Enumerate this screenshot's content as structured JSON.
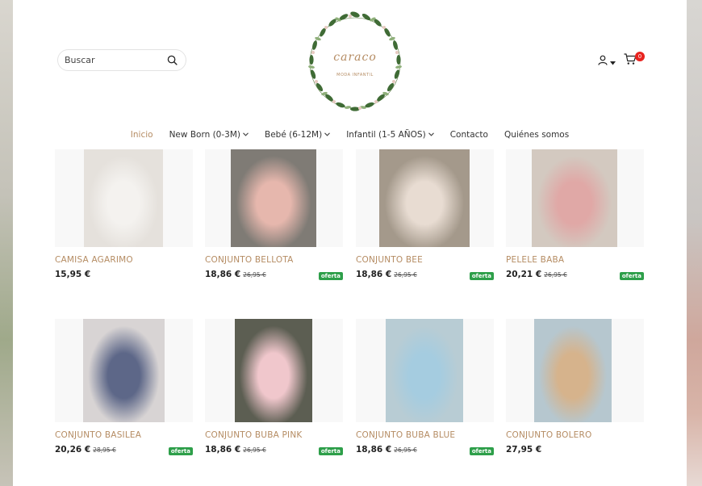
{
  "header": {
    "search": {
      "placeholder": "Buscar",
      "value": ""
    },
    "logo": {
      "brand": "caraco",
      "tagline": "MODA INFANTIL"
    },
    "cart": {
      "count": "0"
    }
  },
  "nav": {
    "items": [
      {
        "label": "Inicio",
        "active": true,
        "has_dropdown": false
      },
      {
        "label": "New Born (0-3M)",
        "active": false,
        "has_dropdown": true
      },
      {
        "label": "Bebé (6-12M)",
        "active": false,
        "has_dropdown": true
      },
      {
        "label": "Infantil (1-5 AÑOS)",
        "active": false,
        "has_dropdown": true
      },
      {
        "label": "Contacto",
        "active": false,
        "has_dropdown": false
      },
      {
        "label": "Quiénes somos",
        "active": false,
        "has_dropdown": false
      }
    ]
  },
  "products": [
    {
      "name": "CAMISA AGARIMO",
      "price": "15,95 €",
      "old_price": "",
      "badge": ""
    },
    {
      "name": "CONJUNTO BELLOTA",
      "price": "18,86 €",
      "old_price": "26,95 €",
      "badge": "oferta"
    },
    {
      "name": "CONJUNTO BEE",
      "price": "18,86 €",
      "old_price": "26,95 €",
      "badge": "oferta"
    },
    {
      "name": "PELELE BABA",
      "price": "20,21 €",
      "old_price": "26,95 €",
      "badge": "oferta"
    },
    {
      "name": "CONJUNTO BASILEA",
      "price": "20,26 €",
      "old_price": "28,95 €",
      "badge": "oferta"
    },
    {
      "name": "CONJUNTO BUBA PINK",
      "price": "18,86 €",
      "old_price": "26,95 €",
      "badge": "oferta"
    },
    {
      "name": "CONJUNTO BUBA BLUE",
      "price": "18,86 €",
      "old_price": "26,95 €",
      "badge": "oferta"
    },
    {
      "name": "CONJUNTO BOLERO",
      "price": "27,95 €",
      "old_price": "",
      "badge": ""
    }
  ],
  "colors": {
    "accent": "#b58c63",
    "badge": "#2e9f4a",
    "cart_badge": "#e8231f"
  },
  "icons": [
    "search-icon",
    "user-icon",
    "chevron-down-icon",
    "cart-icon"
  ]
}
